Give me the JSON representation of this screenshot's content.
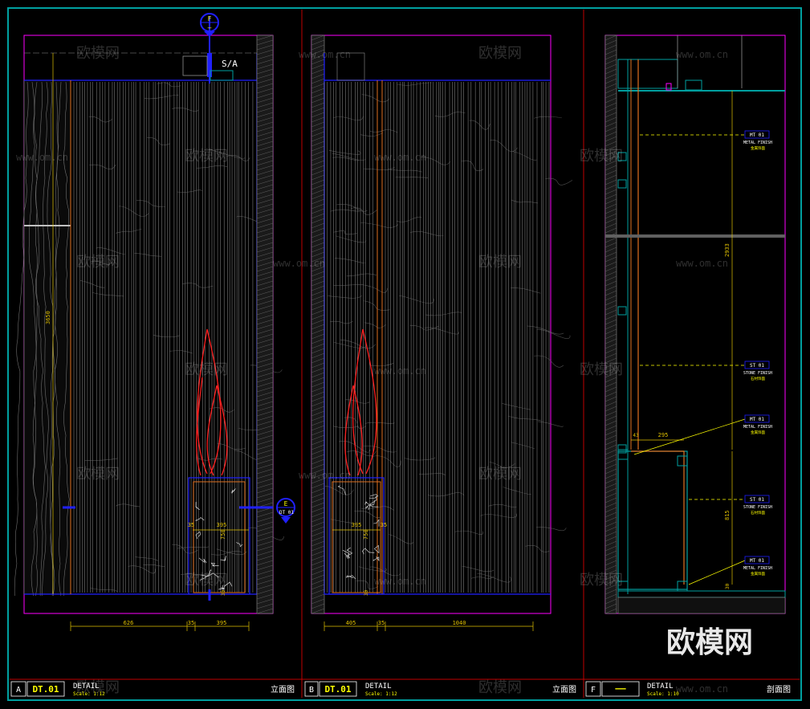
{
  "section_marker_top": {
    "letter": "F",
    "ref": "—"
  },
  "section_marker_side": {
    "letter": "E",
    "ref": "DT 01"
  },
  "sa_label": "S/A",
  "watermark": {
    "brand": "欧模网",
    "url": "www.om.cn"
  },
  "panels": [
    {
      "id": "A",
      "code": "DT.01",
      "title": "DETAIL",
      "scale": "Scale: 1:12",
      "type_cn": "立面图",
      "dims": {
        "height": "3650",
        "widths": [
          "626",
          "35",
          "395"
        ],
        "box_w": "395",
        "box_l": "35",
        "box_h": "750",
        "box_b": "30"
      }
    },
    {
      "id": "B",
      "code": "DT.01",
      "title": "DETAIL",
      "scale": "Scale: 1:12",
      "type_cn": "立面图",
      "dims": {
        "widths": [
          "405",
          "35",
          "1040"
        ],
        "box_w": "395",
        "box_r": "35",
        "box_h": "750",
        "box_b": "30"
      }
    },
    {
      "id": "F",
      "code": "——",
      "title": "DETAIL",
      "scale": "Scale: 1:10",
      "type_cn": "剖面图",
      "dims": {
        "upper_h": "2933",
        "lower_h": "815",
        "depth": "295",
        "gap": "43",
        "base": "30"
      }
    }
  ],
  "callouts": [
    {
      "code": "MT 01",
      "en": "METAL FINISH",
      "cn": "金属饰面"
    },
    {
      "code": "ST 01",
      "en": "STONE FINISH",
      "cn": "石材饰面"
    },
    {
      "code": "MT 01",
      "en": "METAL FINISH",
      "cn": "金属饰面"
    },
    {
      "code": "ST 01",
      "en": "STONE FINISH",
      "cn": "石材饰面"
    },
    {
      "code": "MT 01",
      "en": "METAL FINISH",
      "cn": "金属饰面"
    }
  ],
  "logo_text": "欧模网",
  "colors": {
    "frame": "#00a0a0",
    "magenta": "#ff00ff",
    "blue": "#2020ff",
    "red": "#ff2020",
    "yellow": "#ffff00",
    "orange": "#e07020",
    "grey": "#909090",
    "white": "#ffffff"
  }
}
